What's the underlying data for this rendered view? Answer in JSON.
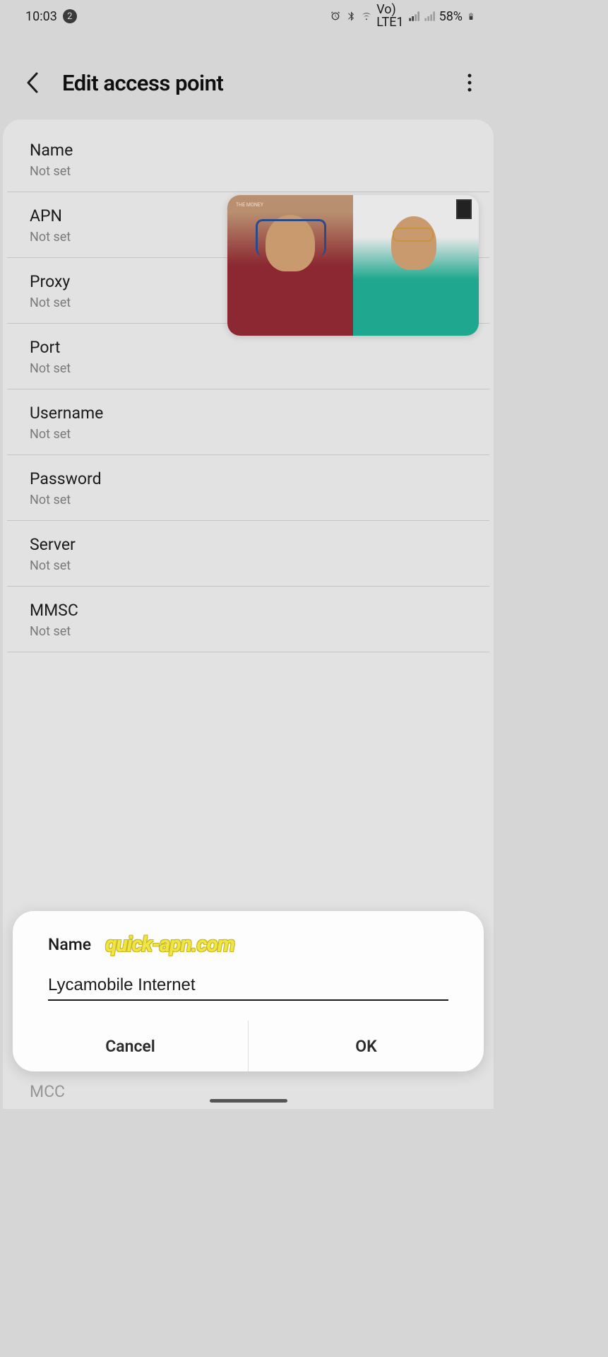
{
  "statusBar": {
    "time": "10:03",
    "notificationCount": "2",
    "batteryPercent": "58%",
    "networkLabel": "LTE1",
    "volteLabel": "Vo)"
  },
  "header": {
    "title": "Edit access point"
  },
  "settings": {
    "items": [
      {
        "label": "Name",
        "value": "Not set"
      },
      {
        "label": "APN",
        "value": "Not set"
      },
      {
        "label": "Proxy",
        "value": "Not set"
      },
      {
        "label": "Port",
        "value": "Not set"
      },
      {
        "label": "Username",
        "value": "Not set"
      },
      {
        "label": "Password",
        "value": "Not set"
      },
      {
        "label": "Server",
        "value": "Not set"
      },
      {
        "label": "MMSC",
        "value": "Not set"
      }
    ],
    "partialNext": "MCC"
  },
  "dialog": {
    "title": "Name",
    "inputValue": "Lycamobile Internet ",
    "cancelLabel": "Cancel",
    "okLabel": "OK"
  },
  "watermark": "quick-apn.com",
  "pip": {
    "logoText": "THE MONEY"
  }
}
